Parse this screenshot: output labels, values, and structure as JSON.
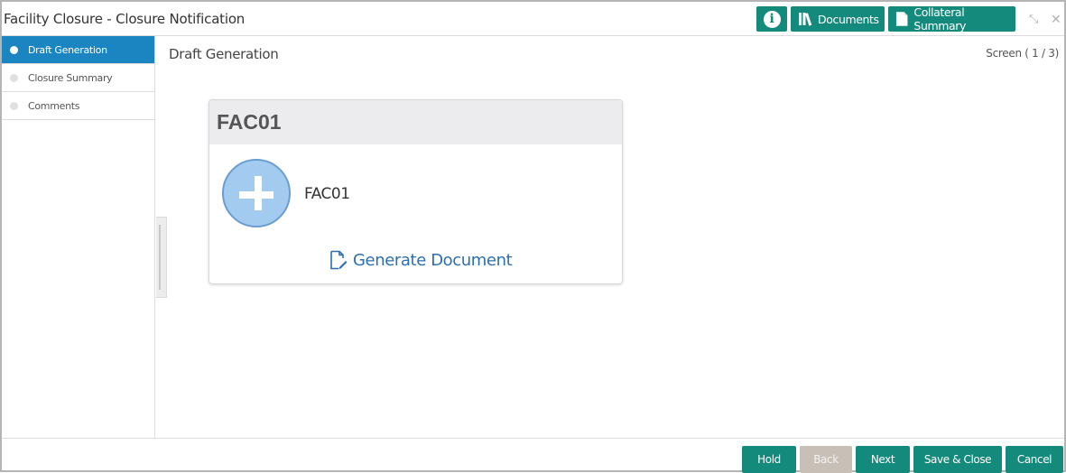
{
  "header": {
    "title": "Facility Closure - Closure Notification",
    "info_label": "i",
    "documents_label": "Documents",
    "collateral_label": "Collateral Summary",
    "minimize_glyph": "⤡",
    "close_glyph": "✕"
  },
  "sidebar": {
    "items": [
      {
        "label": "Draft Generation",
        "active": true
      },
      {
        "label": "Closure Summary",
        "active": false
      },
      {
        "label": "Comments",
        "active": false
      }
    ]
  },
  "main": {
    "page_title": "Draft Generation",
    "screen_indicator": "Screen ( 1 / 3)",
    "card": {
      "header": "FAC01",
      "document_name": "FAC01",
      "generate_label": "Generate Document"
    }
  },
  "footer": {
    "hold": "Hold",
    "back": "Back",
    "next": "Next",
    "save_close": "Save & Close",
    "cancel": "Cancel"
  },
  "colors": {
    "accent": "#148a7d",
    "active_step": "#1a85c1",
    "link": "#2c6fb0",
    "disabled": "#c8bfb6"
  },
  "icons": [
    "info-icon",
    "library-icon",
    "document-icon",
    "minimize-icon",
    "close-icon",
    "plus-icon",
    "edit-document-icon"
  ]
}
